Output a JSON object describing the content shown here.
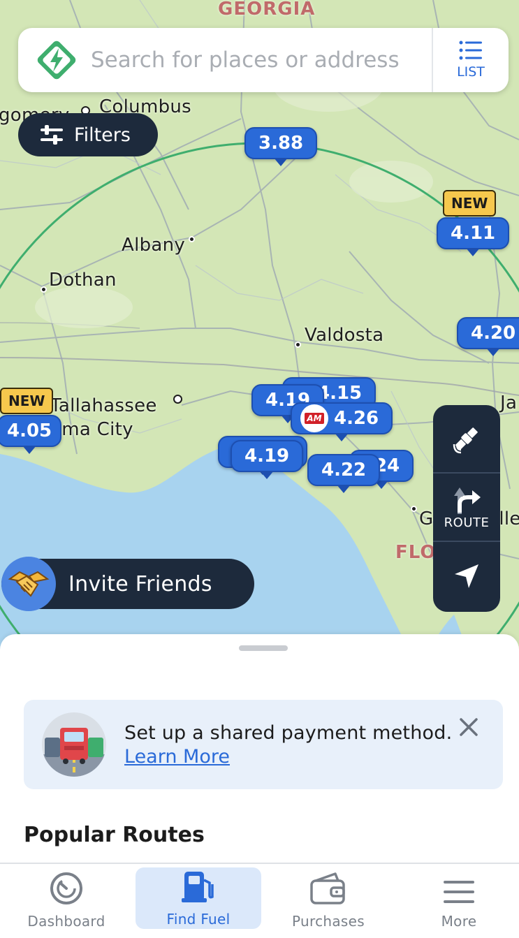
{
  "search": {
    "placeholder": "Search for places or address",
    "list_label": "LIST"
  },
  "filters": {
    "label": "Filters"
  },
  "map": {
    "states": {
      "georgia": "GEORGIA",
      "florida": "FLORIDA"
    },
    "places": {
      "columbus": "Columbus",
      "montgomery": "gomery",
      "albany": "Albany",
      "dothan": "Dothan",
      "valdosta": "Valdosta",
      "tallahassee": "Tallahassee",
      "panama_city": "ama City",
      "jacksonville": "Ja",
      "gainesville": "Gainesville"
    },
    "pins": [
      {
        "price": "3.88"
      },
      {
        "price": "4.11",
        "badge": "NEW"
      },
      {
        "price": "4.20"
      },
      {
        "price": "4.05",
        "badge": "NEW"
      },
      {
        "price": "4.15"
      },
      {
        "price": "4.19"
      },
      {
        "price": "4.26",
        "brand": "AM"
      },
      {
        "price": "4.19"
      },
      {
        "price": "4.22"
      },
      {
        "price": "24"
      }
    ]
  },
  "invite": {
    "label": "Invite Friends"
  },
  "tools": {
    "route_label": "ROUTE"
  },
  "sheet": {
    "promo_message": "Set up a shared payment method.",
    "promo_link": "Learn More",
    "section_title": "Popular Routes"
  },
  "tabs": [
    {
      "label": "Dashboard",
      "icon": "gauge-icon"
    },
    {
      "label": "Find Fuel",
      "icon": "fuel-pump-icon",
      "active": true
    },
    {
      "label": "Purchases",
      "icon": "wallet-icon"
    },
    {
      "label": "More",
      "icon": "menu-icon"
    }
  ],
  "colors": {
    "accent": "#2a6ad8",
    "dark": "#1d2a3c",
    "badge": "#f6c84d",
    "radius_ring": "#3fae6e"
  }
}
